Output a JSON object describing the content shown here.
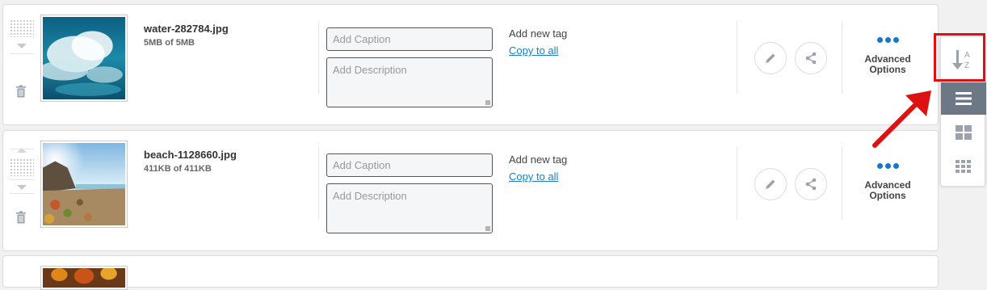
{
  "items": [
    {
      "filename": "water-282784.jpg",
      "size": "5MB of 5MB",
      "caption_placeholder": "Add Caption",
      "description_placeholder": "Add Description",
      "add_tag": "Add new tag",
      "copy_link": "Copy to all",
      "advanced_line1": "Advanced",
      "advanced_line2": "Options"
    },
    {
      "filename": "beach-1128660.jpg",
      "size": "411KB of 411KB",
      "caption_placeholder": "Add Caption",
      "description_placeholder": "Add Description",
      "add_tag": "Add new tag",
      "copy_link": "Copy to all",
      "advanced_line1": "Advanced",
      "advanced_line2": "Options"
    }
  ],
  "sidebar": {
    "sort_icon": "sort-alpha-icon",
    "sort_letters": [
      "A",
      "Z"
    ],
    "views": [
      "list-view-icon",
      "grid-large-icon",
      "grid-small-icon"
    ],
    "active_view": "list-view-icon"
  },
  "colors": {
    "accent": "#1a74c7",
    "link": "#1a7fc1",
    "highlight": "#dd1111",
    "active_view_bg": "#6c7886"
  }
}
